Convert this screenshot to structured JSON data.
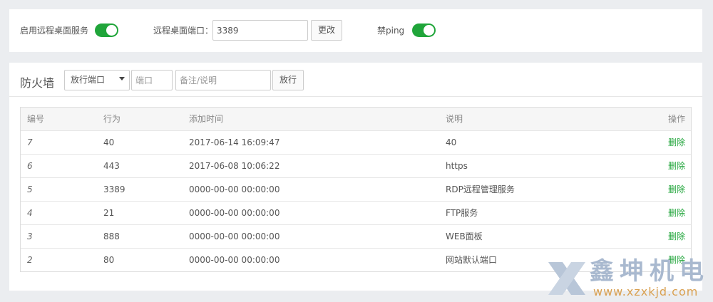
{
  "top_bar": {
    "remote_desktop_label": "启用远程桌面服务",
    "remote_desktop_enabled": true,
    "port_label": "远程桌面端口：",
    "port_value": "3389",
    "change_button": "更改",
    "ping_label": "禁ping",
    "ping_disabled": true
  },
  "firewall": {
    "title": "防火墙",
    "action_select": "放行端口",
    "port_placeholder": "端口",
    "note_placeholder": "备注/说明",
    "allow_button": "放行",
    "columns": [
      "编号",
      "行为",
      "添加时间",
      "说明",
      "操作"
    ],
    "rows": [
      {
        "id": "7",
        "action": "40",
        "time": "2017-06-14 16:09:47",
        "note": "40",
        "op": "删除"
      },
      {
        "id": "6",
        "action": "443",
        "time": "2017-06-08 10:06:22",
        "note": "https",
        "op": "删除"
      },
      {
        "id": "5",
        "action": "3389",
        "time": "0000-00-00 00:00:00",
        "note": "RDP远程管理服务",
        "op": "删除"
      },
      {
        "id": "4",
        "action": "21",
        "time": "0000-00-00 00:00:00",
        "note": "FTP服务",
        "op": "删除"
      },
      {
        "id": "3",
        "action": "888",
        "time": "0000-00-00 00:00:00",
        "note": "WEB面板",
        "op": "删除"
      },
      {
        "id": "2",
        "action": "80",
        "time": "0000-00-00 00:00:00",
        "note": "网站默认端口",
        "op": "删除"
      }
    ]
  },
  "watermark": {
    "brand": "鑫坤机电",
    "url": "www.xzxkjd.com",
    "colors": {
      "brand": "#a9b9cf",
      "url": "#d9a050"
    }
  },
  "colors": {
    "accent": "#20a53a",
    "background": "#ebedf0"
  }
}
